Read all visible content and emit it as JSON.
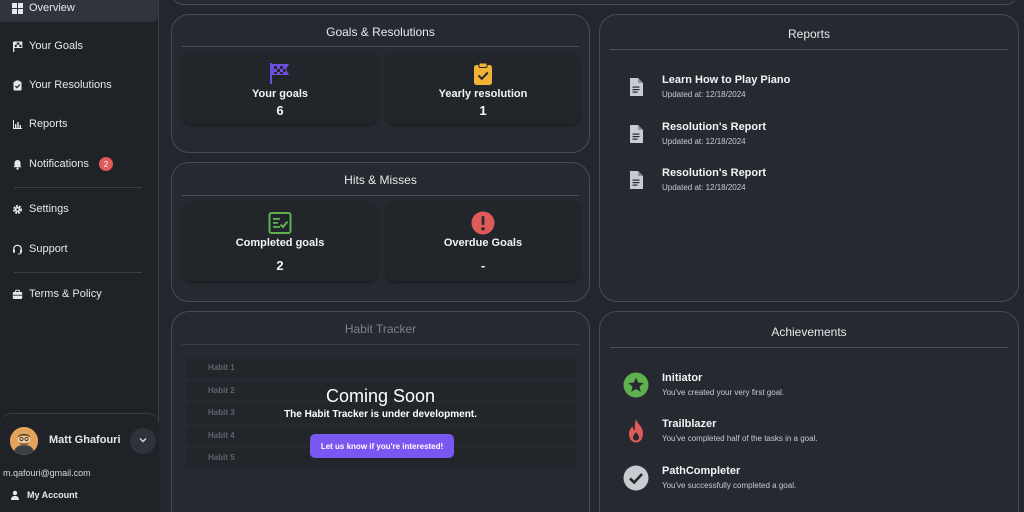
{
  "sidebar": {
    "items": [
      {
        "label": "Overview",
        "icon": "grid-icon"
      },
      {
        "label": "Your Goals",
        "icon": "flag-icon"
      },
      {
        "label": "Your Resolutions",
        "icon": "clipboard-check-icon"
      },
      {
        "label": "Reports",
        "icon": "bar-chart-icon"
      },
      {
        "label": "Notifications",
        "icon": "bell-icon",
        "badge": "2"
      },
      {
        "label": "Settings",
        "icon": "gear-icon"
      },
      {
        "label": "Support",
        "icon": "headset-icon"
      },
      {
        "label": "Terms & Policy",
        "icon": "briefcase-icon"
      }
    ],
    "user": {
      "name": "Matt Ghafouri",
      "email": "m.qafouri@gmail.com",
      "account_label": "My Account"
    }
  },
  "goals_card": {
    "title": "Goals & Resolutions",
    "stats": [
      {
        "label": "Your goals",
        "value": "6",
        "icon": "checkered-flag-icon",
        "color": "#6c4fe0"
      },
      {
        "label": "Yearly resolution",
        "value": "1",
        "icon": "clipboard-check-icon",
        "color": "#f2b233"
      }
    ]
  },
  "hits_card": {
    "title": "Hits & Misses",
    "stats": [
      {
        "label": "Completed goals",
        "value": "2",
        "icon": "checklist-icon",
        "color": "#5fb04f"
      },
      {
        "label": "Overdue Goals",
        "value": "-",
        "icon": "exclamation-circle-icon",
        "color": "#e05a5a"
      }
    ]
  },
  "habit_card": {
    "title": "Habit Tracker",
    "rows": [
      "Habit 1",
      "Habit 2",
      "Habit 3",
      "Habit 4",
      "Habit 5"
    ],
    "coming_title": "Coming Soon",
    "coming_sub": "The Habit Tracker is under development.",
    "cta_label": "Let us know if you're interested!"
  },
  "reports_card": {
    "title": "Reports",
    "items": [
      {
        "title": "Learn How to Play Piano",
        "subtitle": "Updated at: 12/18/2024"
      },
      {
        "title": "Resolution's Report",
        "subtitle": "Updated at: 12/18/2024"
      },
      {
        "title": "Resolution's Report",
        "subtitle": "Updated at: 12/18/2024"
      }
    ]
  },
  "achievements_card": {
    "title": "Achievements",
    "items": [
      {
        "title": "Initiator",
        "subtitle": "You've created your very first goal.",
        "icon": "star-badge-icon",
        "color": "#5fb04f"
      },
      {
        "title": "Trailblazer",
        "subtitle": "You've completed half of the tasks in a goal.",
        "icon": "flame-icon",
        "color": "#e05a5a"
      },
      {
        "title": "PathCompleter",
        "subtitle": "You've successfully completed a goal.",
        "icon": "check-circle-icon",
        "color": "#c8ccd1"
      }
    ]
  },
  "colors": {
    "accent": "#7b57f2",
    "background": "#23272d",
    "card": "#262a30"
  }
}
